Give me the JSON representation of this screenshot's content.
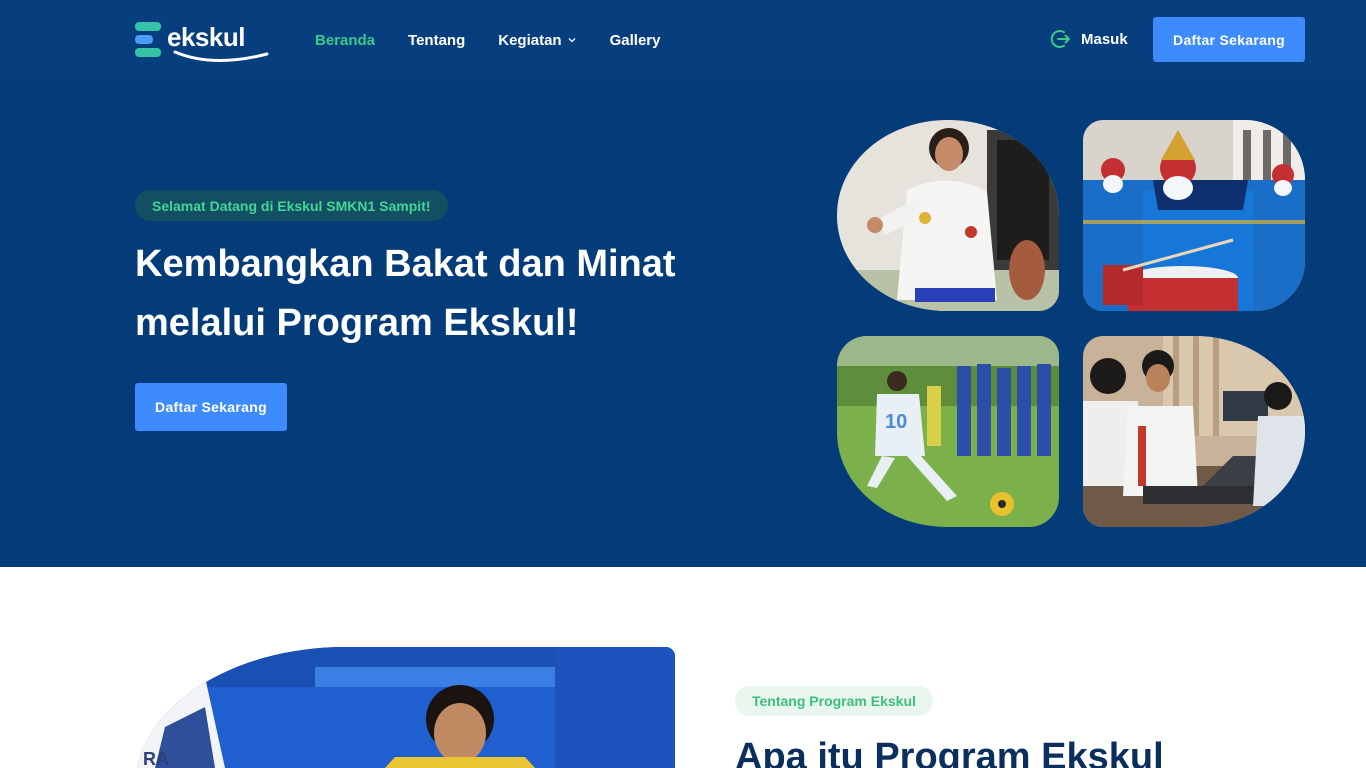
{
  "brand": {
    "name": "ekskul"
  },
  "nav": {
    "links": [
      {
        "label": "Beranda",
        "active": true
      },
      {
        "label": "Tentang"
      },
      {
        "label": "Kegiatan",
        "has_dropdown": true
      },
      {
        "label": "Gallery"
      }
    ],
    "login_label": "Masuk",
    "cta_label": "Daftar Sekarang"
  },
  "hero": {
    "badge": "Selamat Datang di Ekskul SMKN1 Sampit!",
    "title_line1": "Kembangkan Bakat dan Minat",
    "title_line2": "melalui Program Ekskul!",
    "cta_label": "Daftar Sekarang",
    "photos": [
      "karate-photo",
      "marching-band-photo",
      "football-photo",
      "computer-club-photo"
    ]
  },
  "about": {
    "badge": "Tentang Program Ekskul",
    "title": "Apa itu Program Ekskul"
  },
  "colors": {
    "navbar_bg": "#063e7e",
    "hero_bg": "#043c7a",
    "accent_green": "#3dc98a",
    "primary_blue": "#3d8bfd",
    "heading_dark": "#0b2f5c"
  }
}
